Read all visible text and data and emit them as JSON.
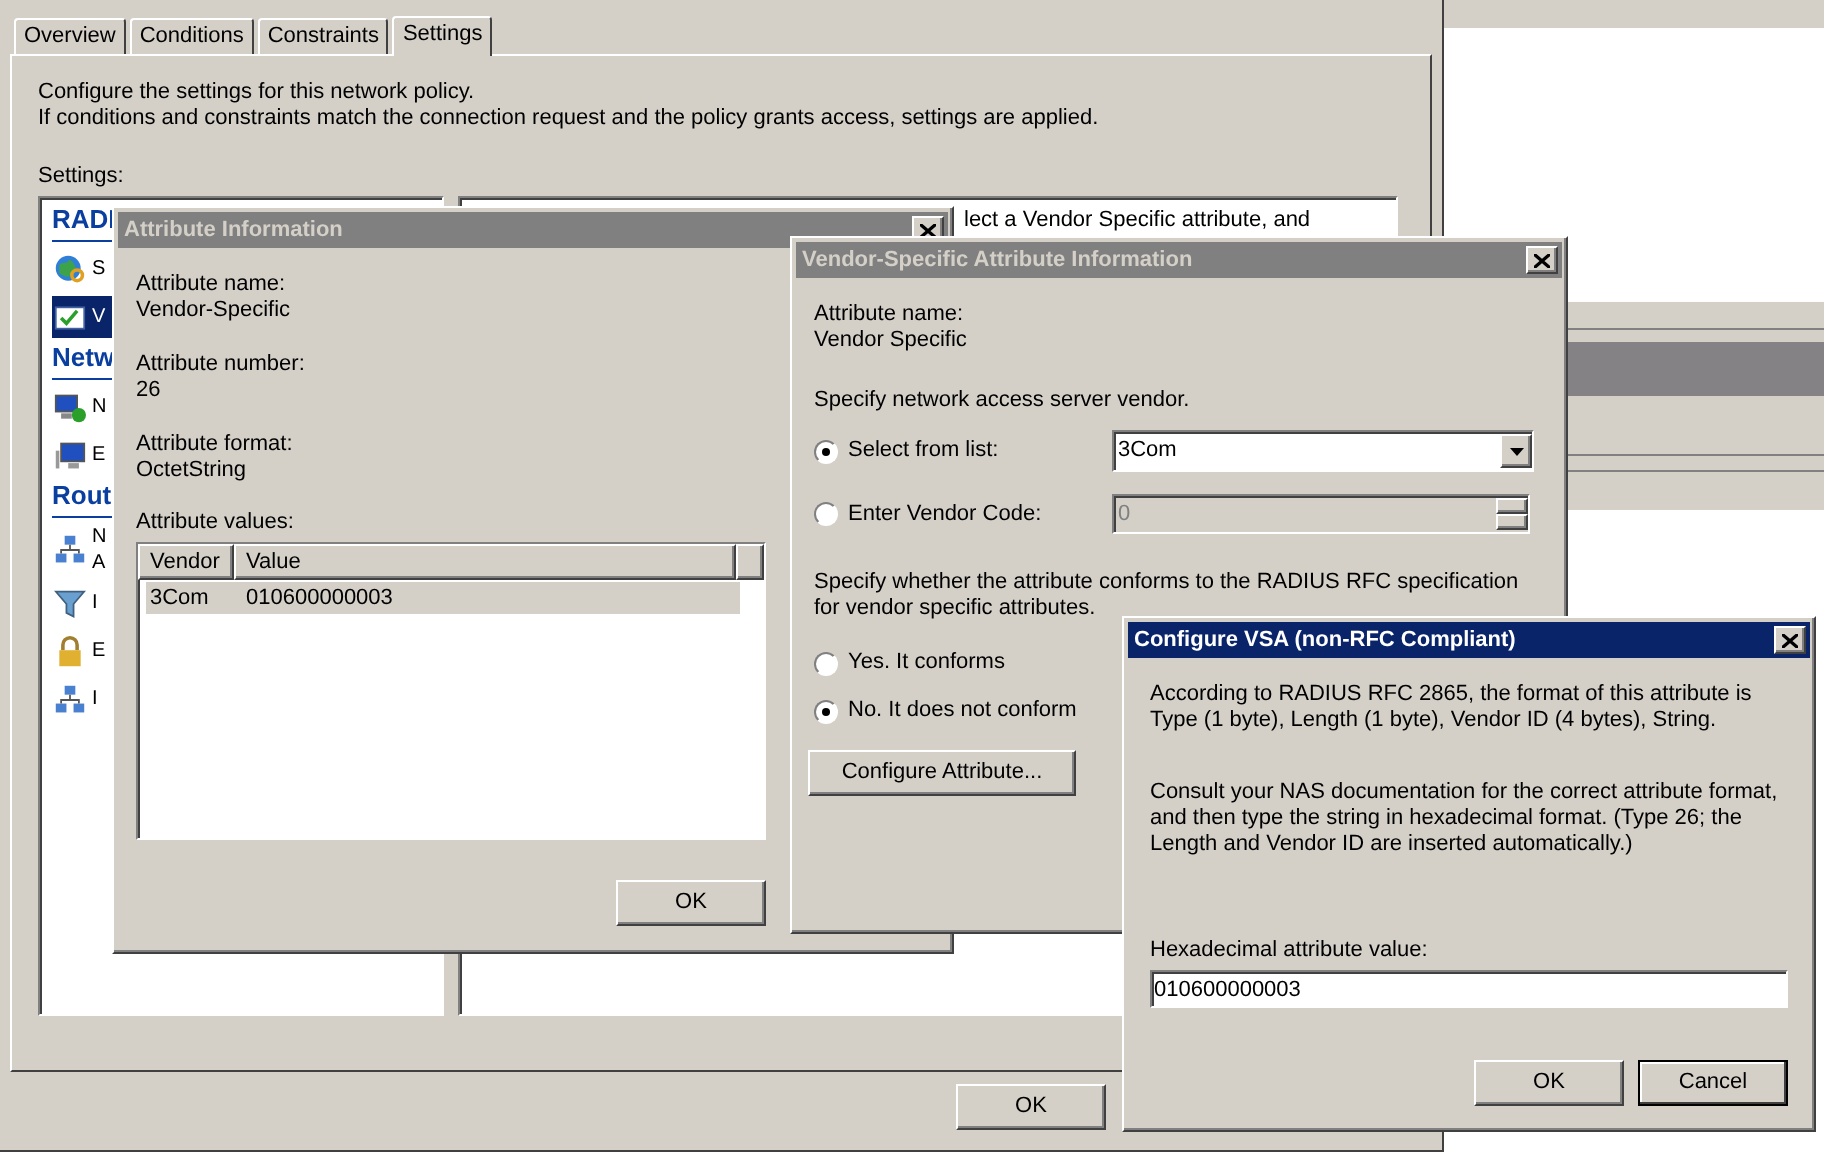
{
  "policy_dialog": {
    "tabs": [
      {
        "label": "Overview",
        "selected": false
      },
      {
        "label": "Conditions",
        "selected": false
      },
      {
        "label": "Constraints",
        "selected": false
      },
      {
        "label": "Settings",
        "selected": true
      }
    ],
    "description": [
      "Configure the settings for this network policy.",
      "If conditions and constraints match the connection request and the policy grants access, settings are applied."
    ],
    "settings_label": "Settings:",
    "settings_list": [
      {
        "kind": "header",
        "label": "RADI"
      },
      {
        "kind": "item",
        "label": "S",
        "selected": false
      },
      {
        "kind": "item",
        "label": "V",
        "selected": true
      },
      {
        "kind": "header",
        "label": "Netw"
      },
      {
        "kind": "item",
        "label": "N",
        "selected": false
      },
      {
        "kind": "item",
        "label": "E",
        "selected": false
      },
      {
        "kind": "header",
        "label": "Rout"
      },
      {
        "kind": "item",
        "label": "N A",
        "selected": false
      },
      {
        "kind": "item",
        "label": "I",
        "selected": false
      },
      {
        "kind": "item",
        "label": "E",
        "selected": false
      },
      {
        "kind": "item",
        "label": "I",
        "selected": false
      }
    ],
    "details_text": "lect a Vendor Specific attribute, and",
    "ok_button": "OK"
  },
  "attribute_dialog": {
    "title": "Attribute Information",
    "active": false,
    "fields": [
      {
        "label": "Attribute name:",
        "value": "Vendor-Specific"
      },
      {
        "label": "Attribute number:",
        "value": "26"
      },
      {
        "label": "Attribute format:",
        "value": "OctetString"
      }
    ],
    "values_label": "Attribute values:",
    "table": {
      "columns": [
        "Vendor",
        "Value"
      ],
      "rows": [
        {
          "cells": [
            "3Com",
            "010600000003"
          ],
          "selected": true
        }
      ]
    },
    "ok_button": "OK"
  },
  "vendor_dialog": {
    "title": "Vendor-Specific Attribute Information",
    "active": false,
    "name_label": "Attribute name:",
    "name_value": "Vendor Specific",
    "vendor_prompt": "Specify network access server vendor.",
    "vendor_source": [
      {
        "kind": "combo",
        "label": "Select from list:",
        "selected": true,
        "value": "3Com",
        "disabled": false
      },
      {
        "kind": "spin",
        "label": "Enter Vendor Code:",
        "selected": false,
        "value": "0",
        "disabled": true
      }
    ],
    "conform_prompt": "Specify whether the attribute conforms to the RADIUS RFC specification for vendor specific attributes.",
    "conformance": [
      {
        "label": "Yes. It conforms",
        "selected": false
      },
      {
        "label": "No. It does not conform",
        "selected": true
      }
    ],
    "configure_button": "Configure Attribute..."
  },
  "vsa_dialog": {
    "title": "Configure VSA (non-RFC Compliant)",
    "active": true,
    "paragraphs": [
      "According to RADIUS RFC 2865, the format of this attribute is Type (1 byte), Length (1 byte), Vendor ID (4 bytes), String.",
      "Consult your NAS documentation for the correct attribute format, and then type the string in hexadecimal format. (Type 26; the Length and Vendor ID are inserted automatically.)"
    ],
    "value_label": "Hexadecimal attribute value:",
    "value": "010600000003",
    "buttons": [
      {
        "label": "OK",
        "default": false
      },
      {
        "label": "Cancel",
        "default": true
      }
    ]
  }
}
